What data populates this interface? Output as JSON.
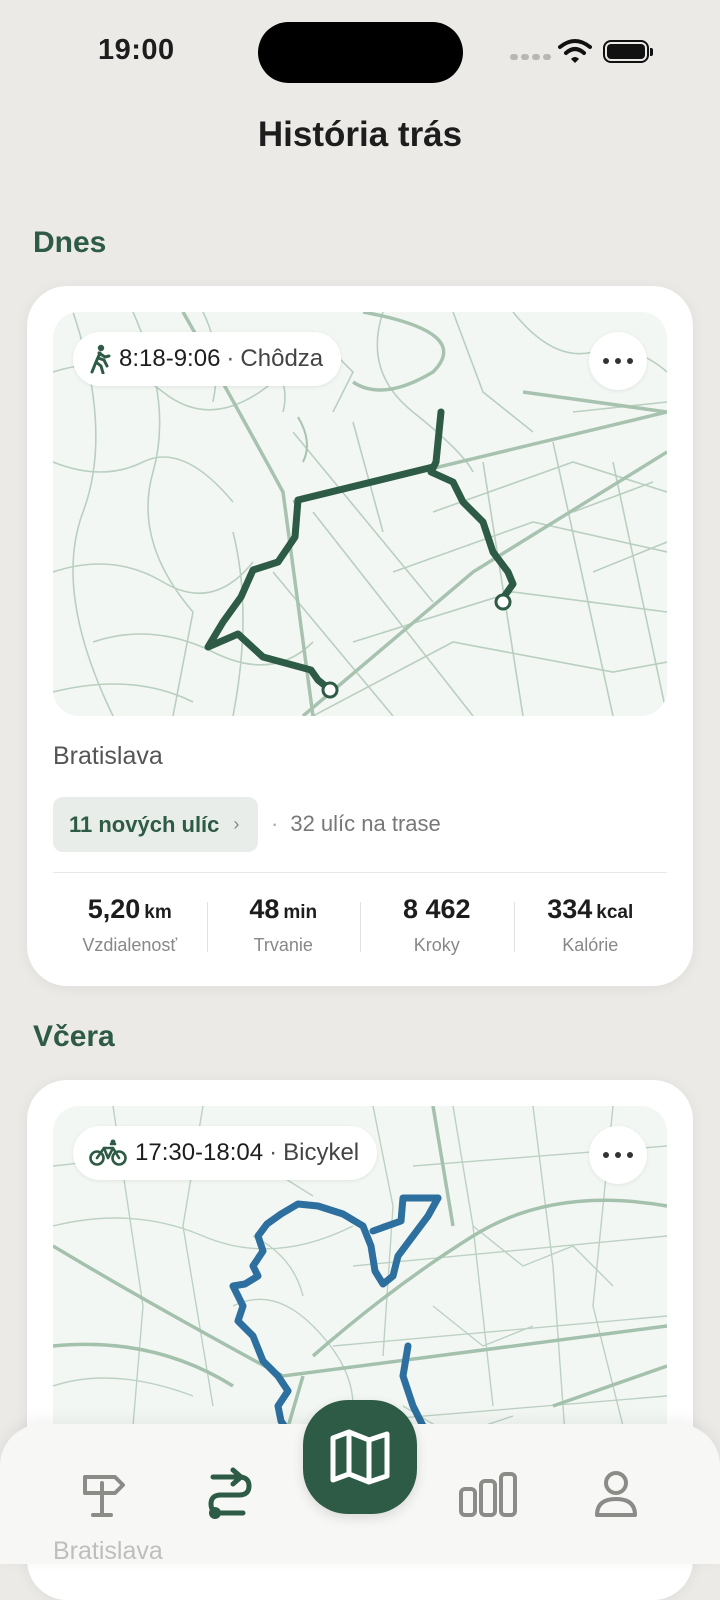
{
  "status": {
    "time": "19:00"
  },
  "header": {
    "title": "História trás"
  },
  "sections": [
    {
      "label": "Dnes",
      "card": {
        "time_range": "8:18-9:06",
        "activity": "Chôdza",
        "activity_icon": "walking-icon",
        "route_color": "#2E5B45",
        "city": "Bratislava",
        "new_streets": "11 nových ulíc",
        "streets_on_route": "32 ulíc na trase",
        "stats": [
          {
            "value": "5,20",
            "unit": "km",
            "label": "Vzdialenosť"
          },
          {
            "value": "48",
            "unit": "min",
            "label": "Trvanie"
          },
          {
            "value": "8 462",
            "unit": "",
            "label": "Kroky"
          },
          {
            "value": "334",
            "unit": "kcal",
            "label": "Kalórie"
          }
        ]
      }
    },
    {
      "label": "Včera",
      "card": {
        "time_range": "17:30-18:04",
        "activity": "Bicykel",
        "activity_icon": "bicycle-icon",
        "route_color": "#2D6F9E",
        "city": "Bratislava"
      }
    }
  ],
  "tabbar": {
    "items": [
      "signpost-icon",
      "route-icon",
      "map-icon",
      "stats-icon",
      "profile-icon"
    ]
  },
  "colors": {
    "accent": "#2E5B45",
    "background": "#ECEAE7",
    "bike_route": "#2D6F9E"
  }
}
